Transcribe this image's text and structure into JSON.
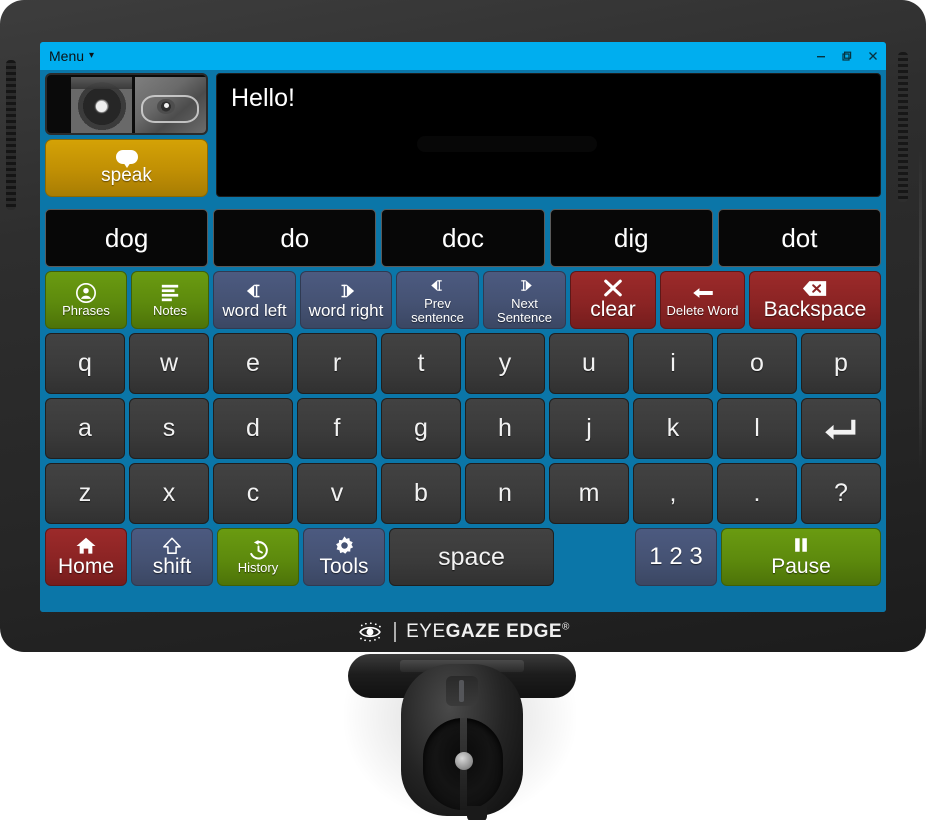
{
  "window": {
    "menu_label": "Menu",
    "menu_caret": "▾",
    "controls": {
      "minimize": "minimize-button",
      "restore": "restore-button",
      "close": "close-button"
    }
  },
  "eye_preview": {
    "name": "eye-tracking-preview",
    "description": "live grayscale eye and face camera view"
  },
  "speak_button": {
    "label": "speak",
    "color": "#c08f04"
  },
  "text_area": {
    "value": "Hello!",
    "placeholder": ""
  },
  "word_predictions": [
    "dog",
    "do",
    "doc",
    "dig",
    "dot"
  ],
  "function_row": [
    {
      "label": "Phrases",
      "icon": "person-circle-icon",
      "color": "#5d8a0d",
      "style": "green",
      "text_size": "sm"
    },
    {
      "label": "Notes",
      "icon": "lines-icon",
      "color": "#5d8a0d",
      "style": "green",
      "text_size": "sm"
    },
    {
      "label": "word left",
      "icon": "caret-left-beam-icon",
      "color": "#455273",
      "style": "blue",
      "text_size": "md"
    },
    {
      "label": "word right",
      "icon": "caret-right-beam-icon",
      "color": "#455273",
      "style": "blue",
      "text_size": "md"
    },
    {
      "label": "Prev sentence",
      "icon": "caret-left-beam-icon",
      "color": "#455273",
      "style": "blue",
      "text_size": "sm"
    },
    {
      "label": "Next Sentence",
      "icon": "caret-right-beam-icon",
      "color": "#455273",
      "style": "blue",
      "text_size": "sm"
    },
    {
      "label": "clear",
      "icon": "x-icon",
      "color": "#8b2424",
      "style": "red",
      "text_size": "lg"
    },
    {
      "label": "Delete Word",
      "icon": "arrow-left-icon",
      "color": "#8b2424",
      "style": "red",
      "text_size": "sm"
    },
    {
      "label": "Backspace",
      "icon": "backspace-icon",
      "color": "#8b2424",
      "style": "red",
      "text_size": "lg"
    }
  ],
  "keyboard": {
    "row1": [
      "q",
      "w",
      "e",
      "r",
      "t",
      "y",
      "u",
      "i",
      "o",
      "p"
    ],
    "row2": [
      "a",
      "s",
      "d",
      "f",
      "g",
      "h",
      "j",
      "k",
      "l"
    ],
    "row2_last": {
      "label": "",
      "icon": "enter-icon",
      "name": "enter-key"
    },
    "row3": [
      "z",
      "x",
      "c",
      "v",
      "b",
      "n",
      "m",
      ",",
      ".",
      "?"
    ]
  },
  "bottom_row": {
    "home": {
      "label": "Home",
      "icon": "home-icon",
      "style": "red"
    },
    "shift": {
      "label": "shift",
      "icon": "shift-up-icon",
      "style": "blue"
    },
    "history": {
      "label": "History",
      "icon": "history-icon",
      "style": "green"
    },
    "tools": {
      "label": "Tools",
      "icon": "gear-icon",
      "style": "blue"
    },
    "space": {
      "label": "space"
    },
    "numbers": {
      "label": "1 2 3",
      "style": "blue"
    },
    "pause": {
      "label": "Pause",
      "icon": "pause-icon",
      "style": "green"
    }
  },
  "brand": {
    "text_light": "EYE",
    "text_bold": "GAZE",
    "text_edge": " EDGE",
    "registered": "®"
  },
  "theme": {
    "accent_blue": "#00aeef",
    "desktop_blue": "#0b76a8",
    "green": "#5d8a0d",
    "slate_blue": "#455273",
    "red": "#8b2424",
    "gold": "#c08f04",
    "key_dark": "#3b3b3b"
  }
}
